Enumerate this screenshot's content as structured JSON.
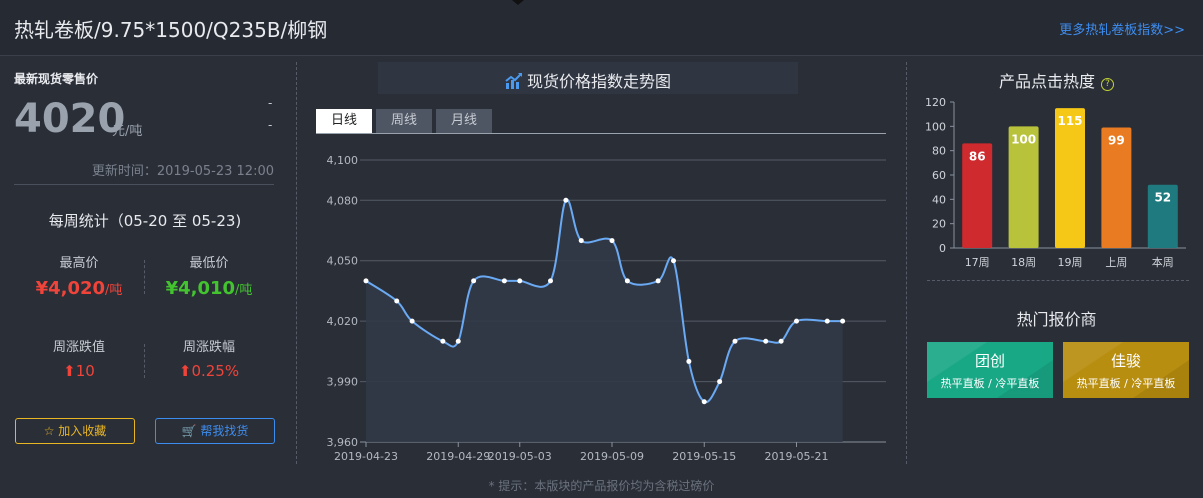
{
  "header": {
    "title": "热轧卷板/9.75*1500/Q235B/柳钢",
    "more_link": "更多热轧卷板指数>>"
  },
  "left": {
    "retail_label": "最新现货零售价",
    "price": "4020",
    "price_unit": "元/吨",
    "dash_1": "-",
    "dash_2": "-",
    "update_time": "更新时间：2019-05-23 12:00",
    "weekly_title": "每周统计（05-20 至 05-23)",
    "high_label": "最高价",
    "high_value": "¥4,020",
    "high_unit": "/吨",
    "low_label": "最低价",
    "low_value": "¥4,010",
    "low_unit": "/吨",
    "change_value_label": "周涨跌值",
    "change_value": "⬆10",
    "change_pct_label": "周涨跌幅",
    "change_pct": "⬆0.25%",
    "fav_button": "☆ 加入收藏",
    "find_button": "🛒 帮我找货",
    "colors": {
      "red": "#f0443a",
      "green": "#43c42f",
      "fav": "#e8b523",
      "find": "#3d8df0"
    }
  },
  "middle": {
    "title_icon": "trend-chart-icon",
    "title": "现货价格指数走势图",
    "tabs": [
      "日线",
      "周线",
      "月线"
    ],
    "active_tab": 0
  },
  "right": {
    "hot_title": "产品点击热度",
    "help_icon": "?",
    "vendor_title": "热门报价商",
    "vendors": [
      {
        "name": "团创",
        "desc": "热平直板 / 冷平直板",
        "color": "#18a886"
      },
      {
        "name": "佳骏",
        "desc": "热平直板 / 冷平直板",
        "color": "#b88e10"
      }
    ]
  },
  "footnote": "* 提示：本版块的产品报价均为含税过磅价",
  "chart_data": [
    {
      "type": "area",
      "x": [
        "2019-04-23",
        "2019-04-25",
        "2019-04-26",
        "2019-04-28",
        "2019-04-29",
        "2019-04-30",
        "2019-05-02",
        "2019-05-03",
        "2019-05-05",
        "2019-05-06",
        "2019-05-07",
        "2019-05-09",
        "2019-05-10",
        "2019-05-12",
        "2019-05-13",
        "2019-05-14",
        "2019-05-15",
        "2019-05-16",
        "2019-05-17",
        "2019-05-19",
        "2019-05-20",
        "2019-05-21",
        "2019-05-23",
        "2019-05-24"
      ],
      "values": [
        4040,
        4030,
        4020,
        4010,
        4010,
        4040,
        4040,
        4040,
        4040,
        4080,
        4060,
        4060,
        4040,
        4040,
        4050,
        4000,
        3980,
        3990,
        4010,
        4010,
        4010,
        4020,
        4020,
        4020
      ],
      "x_ticks": [
        "2019-04-23",
        "2019-04-29",
        "2019-05-03",
        "2019-05-09",
        "2019-05-15",
        "2019-05-21"
      ],
      "y_ticks": [
        3960,
        3990,
        4020,
        4050,
        4080,
        4100
      ],
      "ylim": [
        3960,
        4100
      ],
      "grid": true,
      "colors": {
        "line": "#6aa9f3",
        "area": "#313a48",
        "point": "#ffffff"
      }
    },
    {
      "type": "bar",
      "categories": [
        "17周",
        "18周",
        "19周",
        "上周",
        "本周"
      ],
      "values": [
        86,
        100,
        115,
        99,
        52
      ],
      "y_ticks": [
        0,
        20,
        40,
        60,
        80,
        100,
        120
      ],
      "ylim": [
        0,
        120
      ],
      "colors": [
        "#cf2a2d",
        "#b8c23a",
        "#f5c817",
        "#e97c22",
        "#1f7a80"
      ]
    }
  ]
}
